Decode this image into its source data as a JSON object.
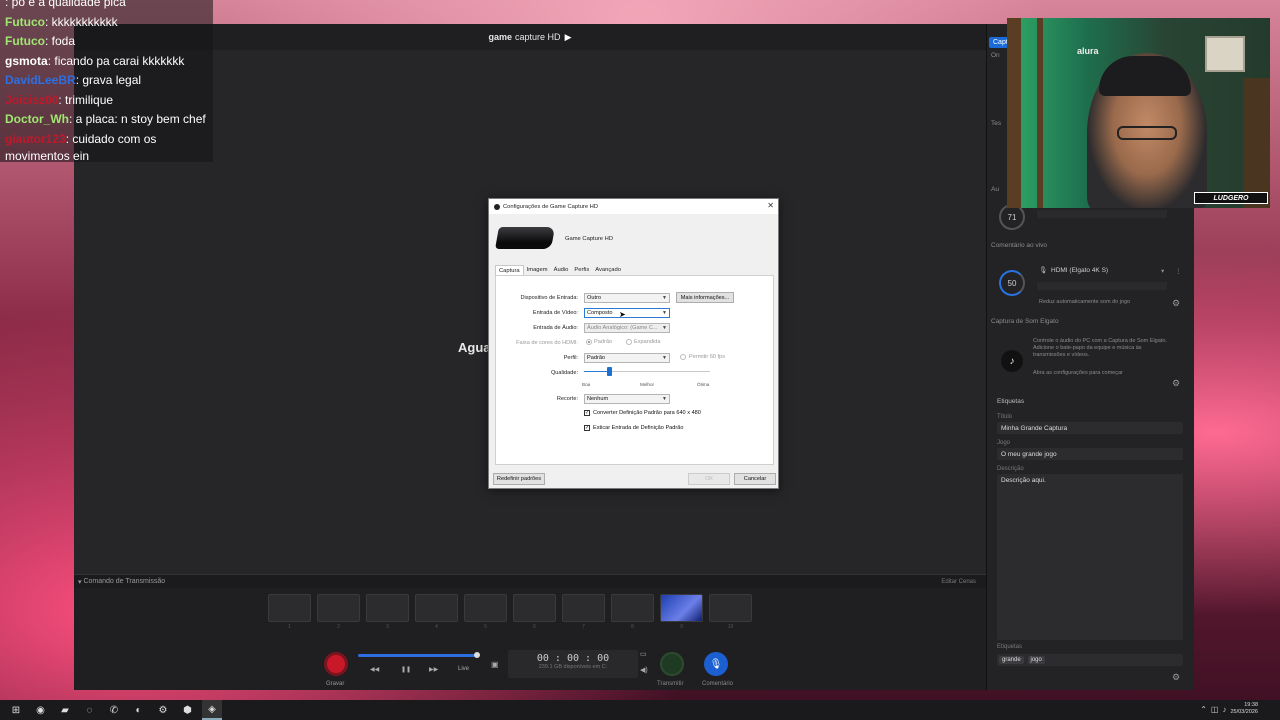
{
  "app": {
    "header_brand": "game",
    "header_title": "capture HD",
    "waiting_text": "Agua",
    "command_bar_label": "Comando de Transmissão",
    "edit_scenes_label": "Editar Cenas",
    "timer": "00 : 00 : 00",
    "storage_text": "239.1 GB disponíveis em C:",
    "record_label": "Gravar",
    "live_label": "Live",
    "stream_label": "Transmitir",
    "comment_label": "Comentário",
    "scene_numbers": [
      "1",
      "2",
      "3",
      "4",
      "5",
      "6",
      "7",
      "8",
      "9",
      "10"
    ]
  },
  "right_panel": {
    "tab_label": "Capt",
    "section_on": "On",
    "section_tes": "Tes",
    "section_au": "Au",
    "knob_audio": "71",
    "comment_live_title": "Comentário ao vivo",
    "knob_comment": "50",
    "mic_device": "HDMI (Elgato 4K S)",
    "reduce_text": "Reduz automaticamente som do jogo",
    "elgato_capture_title": "Captura de Som Elgato",
    "elgato_desc": "Controle o áudio do PC com a Captura de Som Elgato. Adicione o bate-papo da equipe e música às transmissões e vídeos.",
    "elgato_link": "Abra as configurações para começar",
    "tags_title": "Etiquetas",
    "title_label": "Título",
    "title_value": "Minha Grande Captura",
    "game_label": "Jogo",
    "game_value": "O meu grande jogo",
    "desc_label": "Descrição",
    "desc_value": "Descrição aqui.",
    "tags_label": "Etiquetas",
    "tags": [
      "grande",
      "jogo"
    ]
  },
  "chat": {
    "lines": [
      {
        "user": "",
        "text": ": po é a qualidade pica",
        "color": "#d93040"
      },
      {
        "user": "Futuco",
        "text": ": kkkkkkkkkkk",
        "color": "#9fe870"
      },
      {
        "user": "Futuco",
        "text": ": foda",
        "color": "#9fe870"
      },
      {
        "user": "gsmota",
        "text": ": ficando pa carai kkkkkkk",
        "color": "#ffffff"
      },
      {
        "user": "DavidLeeBR",
        "text": ": grava legal",
        "color": "#2f6fe0"
      },
      {
        "user": "Joicisz00",
        "text": ": trimilique",
        "color": "#c0192b"
      },
      {
        "user": "Doctor_Wh",
        "text": ": a placa: n stoy bem chef",
        "color": "#9fe870"
      },
      {
        "user": "giautor123",
        "text": ": cuidado com os movimentos ein",
        "color": "#c0192b"
      }
    ]
  },
  "webcam": {
    "brand": "alura",
    "logo": "LUDGERO"
  },
  "dialog": {
    "title": "Configurações de Game Capture HD",
    "device_name": "Game Capture HD",
    "tabs": [
      "Captura",
      "Imagem",
      "Áudio",
      "Perfis",
      "Avançado"
    ],
    "input_device_label": "Dispositivo de Entrada:",
    "input_device_value": "Outro",
    "more_info_label": "Mais informações...",
    "video_input_label": "Entrada de Vídeo:",
    "video_input_value": "Composto",
    "audio_input_label": "Entrada de Áudio:",
    "audio_input_value": "Áudio Analógico: (Game C...",
    "hdmi_range_label": "Faixa de cores do HDMI:",
    "hdmi_standard": "Padrão",
    "hdmi_expanded": "Expandida",
    "profile_label": "Perfil:",
    "profile_value": "Padrão",
    "allow_60fps": "Permitir 60 fps",
    "quality_label": "Qualidade:",
    "quality_value": 0.2,
    "quality_marks": [
      "Boa",
      "Melhor",
      "Ótima"
    ],
    "crop_label": "Recorte:",
    "crop_value": "Nenhum",
    "convert_sd_label": "Converter Definição Padrão para 640 x 480",
    "stretch_sd_label": "Esticar Entrada de Definição Padrão",
    "reset_label": "Redefinir padrões",
    "ok_label": "OK",
    "cancel_label": "Cancelar"
  },
  "taskbar": {
    "icons": [
      "windows-icon",
      "chrome-icon",
      "folder-icon",
      "app-icon",
      "whatsapp-icon",
      "app-icon",
      "settings-icon",
      "app-icon",
      "elgato-icon"
    ],
    "time": "19:38",
    "date": "25/03/2026"
  }
}
